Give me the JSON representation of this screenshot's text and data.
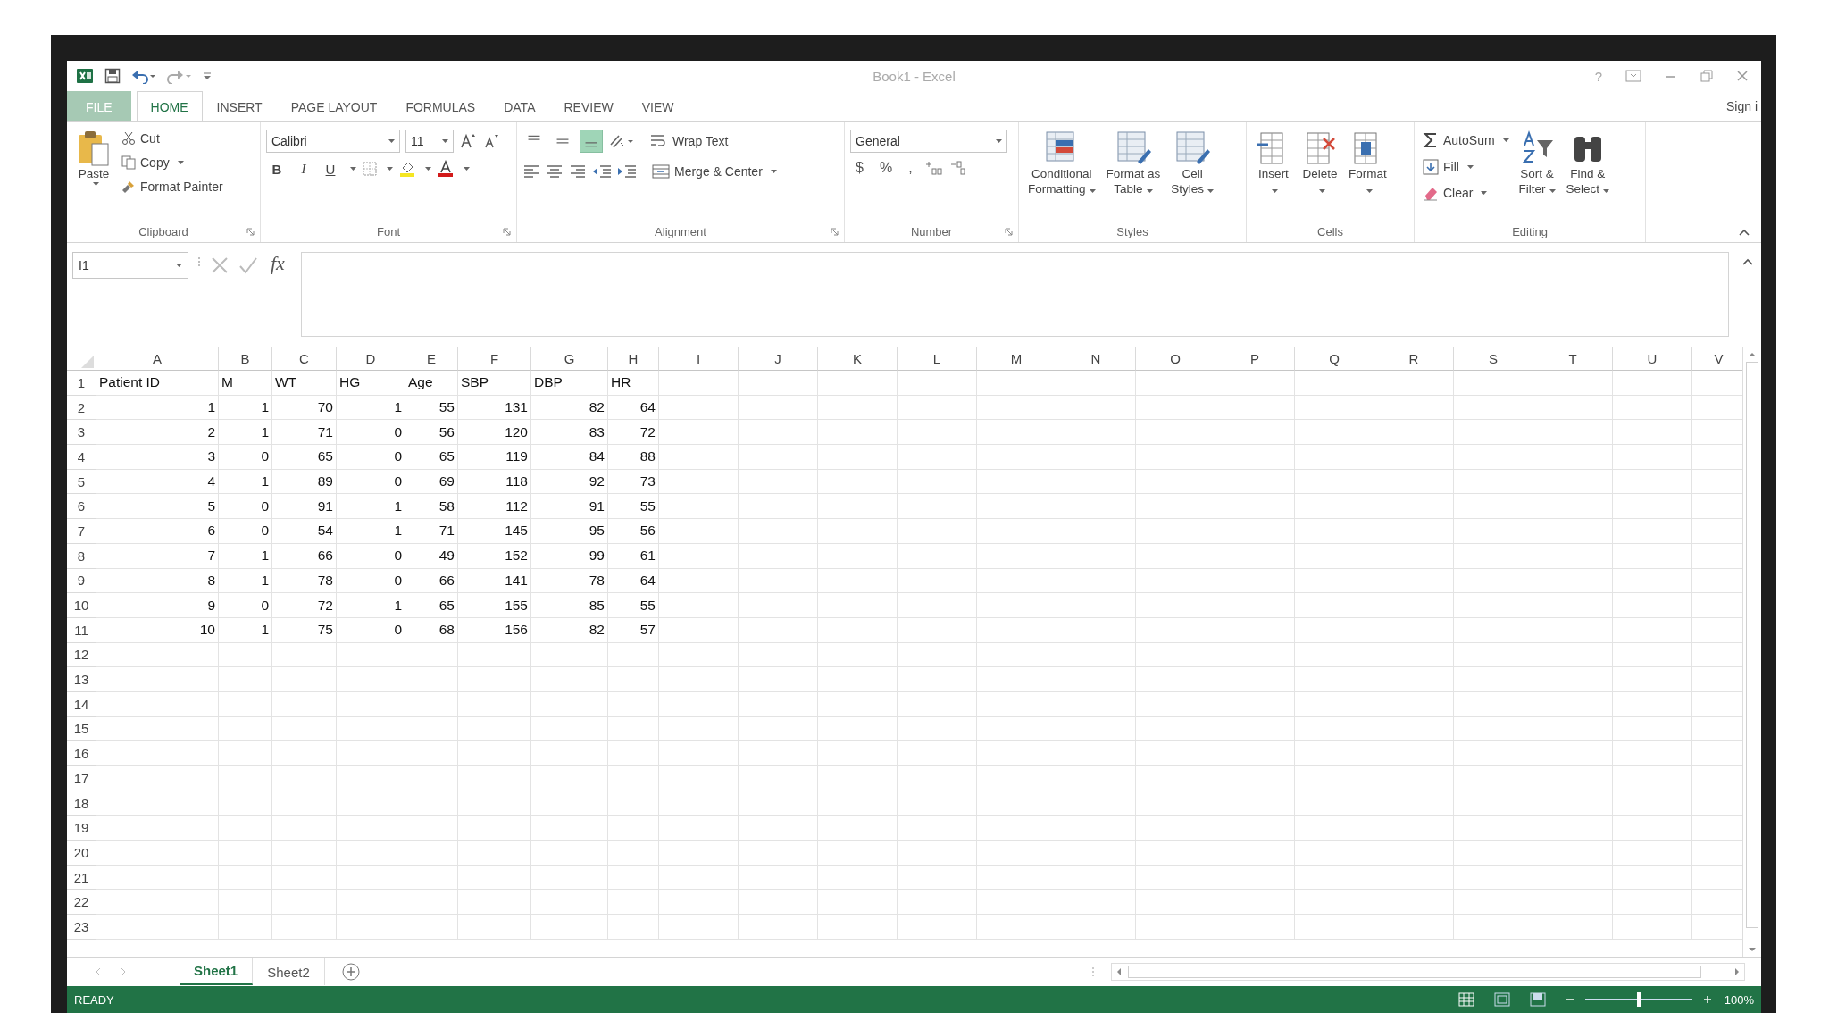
{
  "window": {
    "title": "Book1 - Excel",
    "help": "?",
    "sign_in": "Sign i"
  },
  "tabs": [
    {
      "label": "FILE",
      "kind": "file",
      "selected": false
    },
    {
      "label": "HOME",
      "kind": "tab",
      "selected": true
    },
    {
      "label": "INSERT",
      "kind": "tab",
      "selected": false
    },
    {
      "label": "PAGE LAYOUT",
      "kind": "tab",
      "selected": false
    },
    {
      "label": "FORMULAS",
      "kind": "tab",
      "selected": false
    },
    {
      "label": "DATA",
      "kind": "tab",
      "selected": false
    },
    {
      "label": "REVIEW",
      "kind": "tab",
      "selected": false
    },
    {
      "label": "VIEW",
      "kind": "tab",
      "selected": false
    }
  ],
  "ribbon": {
    "clipboard": {
      "label": "Clipboard",
      "paste": "Paste",
      "cut": "Cut",
      "copy": "Copy",
      "format_painter": "Format Painter"
    },
    "font": {
      "label": "Font",
      "font_name": "Calibri",
      "font_size": "11",
      "styles": [
        "B",
        "I",
        "U"
      ]
    },
    "alignment": {
      "label": "Alignment",
      "vertical": [
        {
          "selected": false
        },
        {
          "selected": false
        },
        {
          "selected": true
        }
      ],
      "wrap": "Wrap Text",
      "merge": "Merge & Center"
    },
    "number": {
      "label": "Number",
      "format": "General",
      "symbols": [
        "$",
        "%",
        ","
      ]
    },
    "styles": {
      "label": "Styles",
      "buttons": [
        {
          "lines": [
            "Conditional",
            "Formatting"
          ]
        },
        {
          "lines": [
            "Format as",
            "Table"
          ]
        },
        {
          "lines": [
            "Cell",
            "Styles"
          ]
        }
      ]
    },
    "cells": {
      "label": "Cells",
      "buttons": [
        "Insert",
        "Delete",
        "Format"
      ]
    },
    "editing": {
      "label": "Editing",
      "autosum": "AutoSum",
      "fill": "Fill",
      "clear": "Clear",
      "buttons": [
        {
          "lines": [
            "Sort &",
            "Filter"
          ]
        },
        {
          "lines": [
            "Find &",
            "Select"
          ]
        }
      ]
    }
  },
  "formula_bar": {
    "name_box": "I1",
    "function_label": "fx"
  },
  "grid": {
    "columns": [
      "A",
      "B",
      "C",
      "D",
      "E",
      "F",
      "G",
      "H",
      "I",
      "J",
      "K",
      "L",
      "M",
      "N",
      "O",
      "P",
      "Q",
      "R",
      "S",
      "T",
      "U",
      "V"
    ],
    "rows": [
      {
        "number": "1",
        "cells": [
          "Patient ID",
          "M",
          "WT",
          "HG",
          "Age",
          "SBP",
          "DBP",
          "HR"
        ]
      },
      {
        "number": "2",
        "cells": [
          "1",
          "1",
          "70",
          "1",
          "55",
          "131",
          "82",
          "64"
        ]
      },
      {
        "number": "3",
        "cells": [
          "2",
          "1",
          "71",
          "0",
          "56",
          "120",
          "83",
          "72"
        ]
      },
      {
        "number": "4",
        "cells": [
          "3",
          "0",
          "65",
          "0",
          "65",
          "119",
          "84",
          "88"
        ]
      },
      {
        "number": "5",
        "cells": [
          "4",
          "1",
          "89",
          "0",
          "69",
          "118",
          "92",
          "73"
        ]
      },
      {
        "number": "6",
        "cells": [
          "5",
          "0",
          "91",
          "1",
          "58",
          "112",
          "91",
          "55"
        ]
      },
      {
        "number": "7",
        "cells": [
          "6",
          "0",
          "54",
          "1",
          "71",
          "145",
          "95",
          "56"
        ]
      },
      {
        "number": "8",
        "cells": [
          "7",
          "1",
          "66",
          "0",
          "49",
          "152",
          "99",
          "61"
        ]
      },
      {
        "number": "9",
        "cells": [
          "8",
          "1",
          "78",
          "0",
          "66",
          "141",
          "78",
          "64"
        ]
      },
      {
        "number": "10",
        "cells": [
          "9",
          "0",
          "72",
          "1",
          "65",
          "155",
          "85",
          "55"
        ]
      },
      {
        "number": "11",
        "cells": [
          "10",
          "1",
          "75",
          "0",
          "68",
          "156",
          "82",
          "57"
        ]
      },
      {
        "number": "12"
      },
      {
        "number": "13"
      },
      {
        "number": "14"
      },
      {
        "number": "15"
      },
      {
        "number": "16"
      },
      {
        "number": "17"
      },
      {
        "number": "18"
      },
      {
        "number": "19"
      },
      {
        "number": "20"
      },
      {
        "number": "21"
      },
      {
        "number": "22"
      },
      {
        "number": "23"
      }
    ]
  },
  "sheets": [
    {
      "label": "Sheet1",
      "selected": true
    },
    {
      "label": "Sheet2",
      "selected": false
    }
  ],
  "status_bar": {
    "status": "READY",
    "zoom": "100%",
    "zoom_slider": {
      "level": 0.5
    }
  }
}
